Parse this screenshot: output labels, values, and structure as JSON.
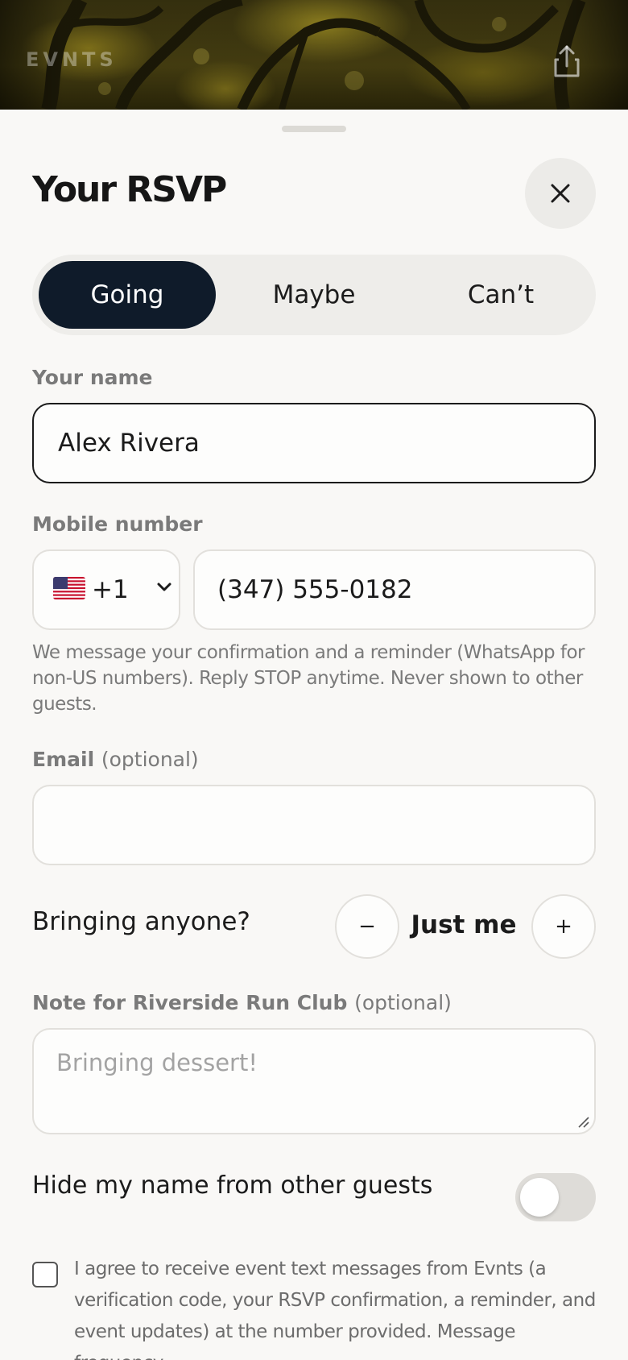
{
  "header": {
    "brand": "EVNTS",
    "share_icon": "share-icon"
  },
  "sheet": {
    "title": "Your RSVP",
    "close_icon": "close-icon"
  },
  "response": {
    "options": [
      "Going",
      "Maybe",
      "Can’t"
    ],
    "selected": "Going"
  },
  "name_field": {
    "label": "Your name",
    "value": "Alex Rivera"
  },
  "mobile_field": {
    "label": "Mobile number",
    "country_code": "+1",
    "country_flag": "us-flag-icon",
    "value": "(347) 555-0182",
    "help": "We message your confirmation and a reminder (WhatsApp for non-US numbers). Reply STOP anytime. Never shown to other guests."
  },
  "email_field": {
    "label": "Email",
    "optional": "(optional)",
    "value": ""
  },
  "guests": {
    "label": "Bringing anyone?",
    "decrement": "−",
    "count_label": "Just me",
    "increment": "+"
  },
  "note_field": {
    "label": "Note for Riverside Run Club",
    "optional": "(optional)",
    "placeholder": "Bringing dessert!"
  },
  "privacy": {
    "label": "Hide my name from other guests",
    "enabled": false
  },
  "consent": {
    "checked": false,
    "text": "I agree to receive event text messages from Evnts (a verification code, your RSVP confirmation, a reminder, and event updates) at the number provided. Message frequency"
  },
  "colors": {
    "accent": "#0f1b2a",
    "background": "#f9f8f6",
    "muted_text": "#7a7a7a"
  }
}
